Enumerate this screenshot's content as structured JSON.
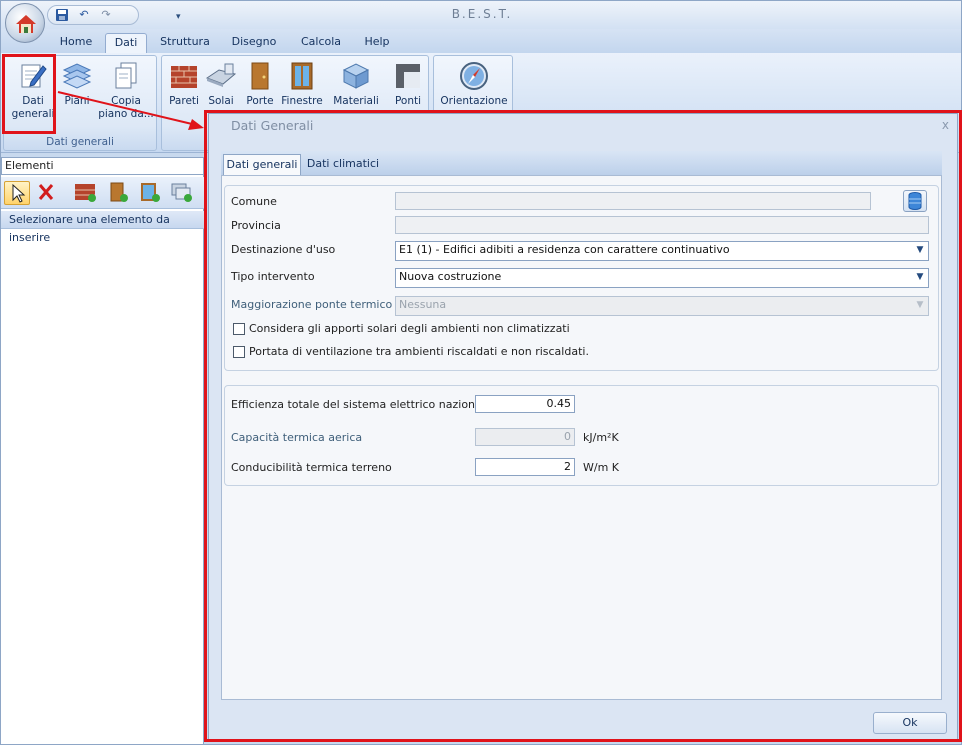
{
  "app": {
    "title": "B.E.S.T."
  },
  "tabs": [
    "Home",
    "Dati",
    "Struttura",
    "Disegno",
    "Calcola",
    "Help"
  ],
  "ribbon": {
    "dati_generali_group": {
      "label": "Dati generali",
      "buttons": [
        "Dati\ngenerali",
        "Piani",
        "Copia\npiano da..."
      ]
    },
    "elements_group": {
      "buttons": [
        "Pareti",
        "Solai",
        "Porte",
        "Finestre",
        "Materiali",
        "Ponti",
        "Orientazione"
      ]
    }
  },
  "leftpanel": {
    "combo": "Elementi",
    "hint": "Selezionare una elemento da inserire"
  },
  "dialog": {
    "title": "Dati Generali",
    "close": "x",
    "tabs": [
      "Dati generali",
      "Dati climatici"
    ],
    "labels": {
      "comune": "Comune",
      "provincia": "Provincia",
      "destinazione": "Destinazione d'uso",
      "tipo": "Tipo intervento",
      "maggiorazione": "Maggiorazione ponte termico",
      "efficienza": "Efficienza totale del sistema elettrico nazionale",
      "capacita": "Capacità termica aerica",
      "conducibilita": "Conducibilità termica terreno"
    },
    "values": {
      "comune": "",
      "provincia": "",
      "destinazione": "E1 (1) - Edifici adibiti a residenza con carattere continuativo",
      "tipo": "Nuova costruzione",
      "maggiorazione": "Nessuna",
      "efficienza": "0.45",
      "capacita": "0",
      "conducibilita": "2"
    },
    "units": {
      "capacita": "kJ/m²K",
      "conducibilita": "W/m K"
    },
    "checkboxes": [
      "Considera gli apporti solari degli ambienti non climatizzati",
      "Portata di ventilazione tra ambienti riscaldati e non riscaldati."
    ],
    "ok": "Ok"
  },
  "colors": {
    "callout": "#e0131a",
    "ribbon": "#d2e1f4",
    "accent": "#15325e"
  }
}
